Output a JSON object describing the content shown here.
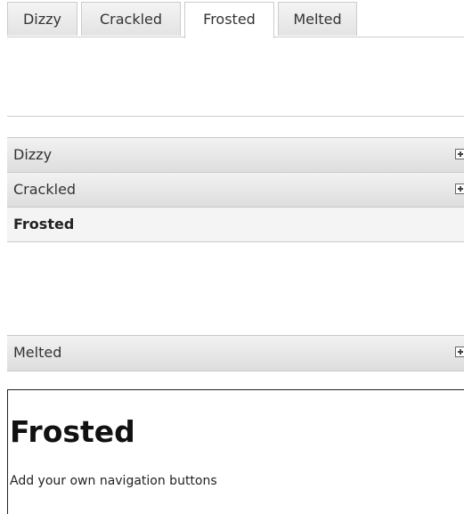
{
  "tabs": {
    "items": [
      {
        "label": "Dizzy"
      },
      {
        "label": "Crackled"
      },
      {
        "label": "Frosted"
      },
      {
        "label": "Melted"
      }
    ],
    "active_label": "Frosted"
  },
  "accordion": {
    "sections": [
      {
        "label": "Dizzy",
        "icon": "plus-icon"
      },
      {
        "label": "Crackled",
        "icon": "plus-icon"
      },
      {
        "label": "Frosted",
        "icon": "none"
      },
      {
        "label": "Melted",
        "icon": "plus-icon"
      }
    ],
    "open_label": "Frosted"
  },
  "content": {
    "title": "Frosted",
    "link_text": "Add your own navigation buttons"
  },
  "colors": {
    "border": "#cccccc",
    "header_gradient_top": "#f2f2f2",
    "header_gradient_bottom": "#dddddd",
    "text": "#333333"
  }
}
